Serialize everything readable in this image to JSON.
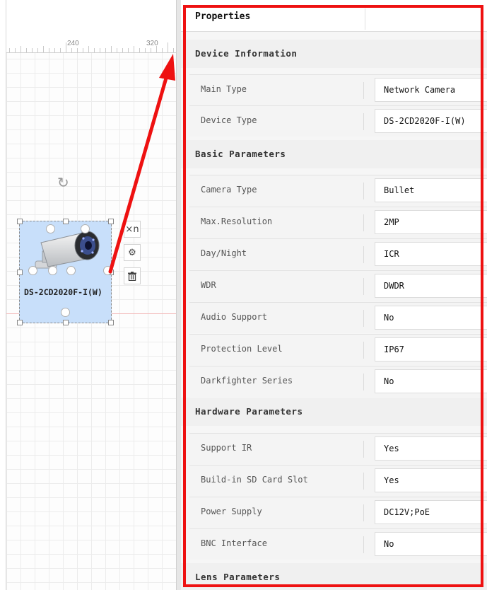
{
  "canvas": {
    "ruler_labels": [
      "240",
      "320"
    ],
    "device": {
      "label": "DS-2CD2020F-I(W)",
      "tools": [
        "×n",
        "gear-icon",
        "trash-icon"
      ]
    }
  },
  "panel": {
    "title": "Properties",
    "accent_color": "#ee1111",
    "sections": {
      "device_information": "Device Information",
      "basic_parameters": "Basic Parameters",
      "hardware_parameters": "Hardware Parameters",
      "lens_parameters": "Lens Parameters"
    },
    "rows": [
      {
        "label": "Main Type",
        "value": "Network Camera"
      },
      {
        "label": "Device Type",
        "value": "DS-2CD2020F-I(W)"
      },
      {
        "label": "Camera Type",
        "value": "Bullet"
      },
      {
        "label": "Max.Resolution",
        "value": "2MP"
      },
      {
        "label": "Day/Night",
        "value": "ICR"
      },
      {
        "label": "WDR",
        "value": "DWDR"
      },
      {
        "label": "Audio Support",
        "value": "No"
      },
      {
        "label": "Protection Level",
        "value": "IP67"
      },
      {
        "label": "Darkfighter Series",
        "value": "No"
      },
      {
        "label": "Support IR",
        "value": "Yes"
      },
      {
        "label": "Build-in SD Card Slot",
        "value": "Yes"
      },
      {
        "label": "Power Supply",
        "value": "DC12V;PoE"
      },
      {
        "label": "BNC Interface",
        "value": "No"
      }
    ]
  }
}
